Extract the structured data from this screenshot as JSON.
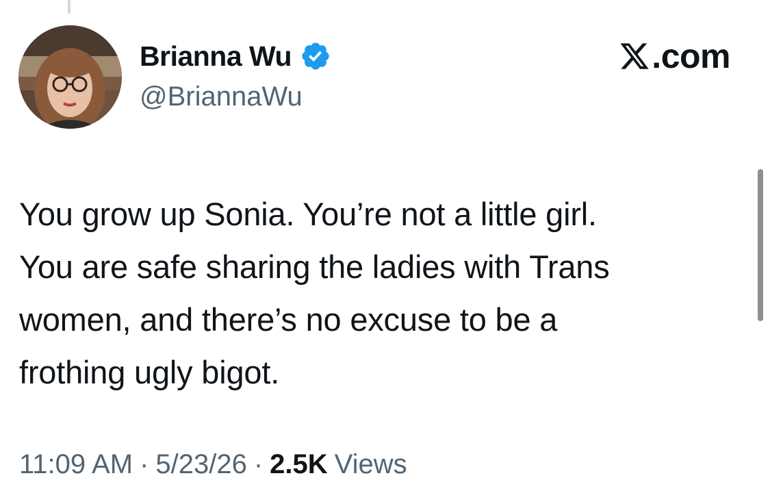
{
  "tweet": {
    "author": {
      "display_name": "Brianna Wu",
      "handle": "@BriannaWu",
      "verified": true,
      "verified_color": "#1d9bf0"
    },
    "brand": {
      "label": ".com",
      "icon": "x-logo-icon"
    },
    "text": "You grow up Sonia. You’re not a little girl.\nYou are safe sharing the ladies with Trans\nwomen, and there’s no excuse to be a\nfrothing ugly bigot.",
    "time": "11:09 AM",
    "date": "5/23/26",
    "separator": "·",
    "views_count": "2.5K",
    "views_label": "Views"
  },
  "colors": {
    "text_primary": "#0f1419",
    "text_secondary": "#536471",
    "verified": "#1d9bf0",
    "scrollbar": "#8e8e93"
  }
}
